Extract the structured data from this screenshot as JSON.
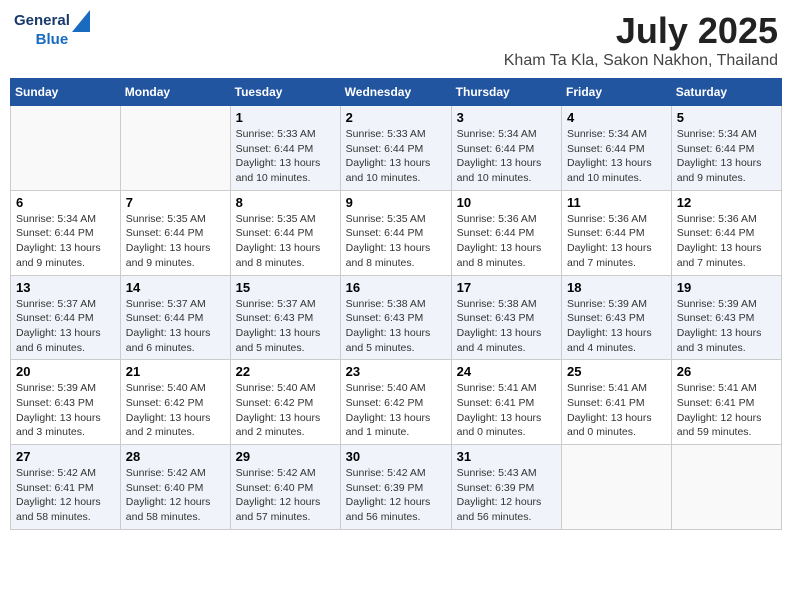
{
  "header": {
    "logo_line1": "General",
    "logo_line2": "Blue",
    "title": "July 2025",
    "subtitle": "Kham Ta Kla, Sakon Nakhon, Thailand"
  },
  "days_of_week": [
    "Sunday",
    "Monday",
    "Tuesday",
    "Wednesday",
    "Thursday",
    "Friday",
    "Saturday"
  ],
  "weeks": [
    [
      {
        "day": "",
        "info": ""
      },
      {
        "day": "",
        "info": ""
      },
      {
        "day": "1",
        "info": "Sunrise: 5:33 AM\nSunset: 6:44 PM\nDaylight: 13 hours and 10 minutes."
      },
      {
        "day": "2",
        "info": "Sunrise: 5:33 AM\nSunset: 6:44 PM\nDaylight: 13 hours and 10 minutes."
      },
      {
        "day": "3",
        "info": "Sunrise: 5:34 AM\nSunset: 6:44 PM\nDaylight: 13 hours and 10 minutes."
      },
      {
        "day": "4",
        "info": "Sunrise: 5:34 AM\nSunset: 6:44 PM\nDaylight: 13 hours and 10 minutes."
      },
      {
        "day": "5",
        "info": "Sunrise: 5:34 AM\nSunset: 6:44 PM\nDaylight: 13 hours and 9 minutes."
      }
    ],
    [
      {
        "day": "6",
        "info": "Sunrise: 5:34 AM\nSunset: 6:44 PM\nDaylight: 13 hours and 9 minutes."
      },
      {
        "day": "7",
        "info": "Sunrise: 5:35 AM\nSunset: 6:44 PM\nDaylight: 13 hours and 9 minutes."
      },
      {
        "day": "8",
        "info": "Sunrise: 5:35 AM\nSunset: 6:44 PM\nDaylight: 13 hours and 8 minutes."
      },
      {
        "day": "9",
        "info": "Sunrise: 5:35 AM\nSunset: 6:44 PM\nDaylight: 13 hours and 8 minutes."
      },
      {
        "day": "10",
        "info": "Sunrise: 5:36 AM\nSunset: 6:44 PM\nDaylight: 13 hours and 8 minutes."
      },
      {
        "day": "11",
        "info": "Sunrise: 5:36 AM\nSunset: 6:44 PM\nDaylight: 13 hours and 7 minutes."
      },
      {
        "day": "12",
        "info": "Sunrise: 5:36 AM\nSunset: 6:44 PM\nDaylight: 13 hours and 7 minutes."
      }
    ],
    [
      {
        "day": "13",
        "info": "Sunrise: 5:37 AM\nSunset: 6:44 PM\nDaylight: 13 hours and 6 minutes."
      },
      {
        "day": "14",
        "info": "Sunrise: 5:37 AM\nSunset: 6:44 PM\nDaylight: 13 hours and 6 minutes."
      },
      {
        "day": "15",
        "info": "Sunrise: 5:37 AM\nSunset: 6:43 PM\nDaylight: 13 hours and 5 minutes."
      },
      {
        "day": "16",
        "info": "Sunrise: 5:38 AM\nSunset: 6:43 PM\nDaylight: 13 hours and 5 minutes."
      },
      {
        "day": "17",
        "info": "Sunrise: 5:38 AM\nSunset: 6:43 PM\nDaylight: 13 hours and 4 minutes."
      },
      {
        "day": "18",
        "info": "Sunrise: 5:39 AM\nSunset: 6:43 PM\nDaylight: 13 hours and 4 minutes."
      },
      {
        "day": "19",
        "info": "Sunrise: 5:39 AM\nSunset: 6:43 PM\nDaylight: 13 hours and 3 minutes."
      }
    ],
    [
      {
        "day": "20",
        "info": "Sunrise: 5:39 AM\nSunset: 6:43 PM\nDaylight: 13 hours and 3 minutes."
      },
      {
        "day": "21",
        "info": "Sunrise: 5:40 AM\nSunset: 6:42 PM\nDaylight: 13 hours and 2 minutes."
      },
      {
        "day": "22",
        "info": "Sunrise: 5:40 AM\nSunset: 6:42 PM\nDaylight: 13 hours and 2 minutes."
      },
      {
        "day": "23",
        "info": "Sunrise: 5:40 AM\nSunset: 6:42 PM\nDaylight: 13 hours and 1 minute."
      },
      {
        "day": "24",
        "info": "Sunrise: 5:41 AM\nSunset: 6:41 PM\nDaylight: 13 hours and 0 minutes."
      },
      {
        "day": "25",
        "info": "Sunrise: 5:41 AM\nSunset: 6:41 PM\nDaylight: 13 hours and 0 minutes."
      },
      {
        "day": "26",
        "info": "Sunrise: 5:41 AM\nSunset: 6:41 PM\nDaylight: 12 hours and 59 minutes."
      }
    ],
    [
      {
        "day": "27",
        "info": "Sunrise: 5:42 AM\nSunset: 6:41 PM\nDaylight: 12 hours and 58 minutes."
      },
      {
        "day": "28",
        "info": "Sunrise: 5:42 AM\nSunset: 6:40 PM\nDaylight: 12 hours and 58 minutes."
      },
      {
        "day": "29",
        "info": "Sunrise: 5:42 AM\nSunset: 6:40 PM\nDaylight: 12 hours and 57 minutes."
      },
      {
        "day": "30",
        "info": "Sunrise: 5:42 AM\nSunset: 6:39 PM\nDaylight: 12 hours and 56 minutes."
      },
      {
        "day": "31",
        "info": "Sunrise: 5:43 AM\nSunset: 6:39 PM\nDaylight: 12 hours and 56 minutes."
      },
      {
        "day": "",
        "info": ""
      },
      {
        "day": "",
        "info": ""
      }
    ]
  ]
}
